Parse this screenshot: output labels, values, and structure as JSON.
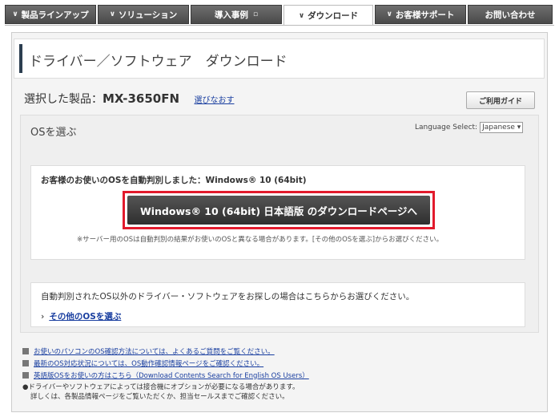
{
  "nav": {
    "tabs": [
      {
        "label": "製品ラインアップ",
        "chevron": true
      },
      {
        "label": "ソリューション",
        "chevron": true
      },
      {
        "label": "導入事例",
        "chevron": false
      },
      {
        "label": "ダウンロード",
        "chevron": true,
        "active": true
      },
      {
        "label": "お客様サポート",
        "chevron": true
      },
      {
        "label": "お問い合わせ",
        "chevron": false
      }
    ]
  },
  "header": {
    "title": "ドライバー／ソフトウェア　ダウンロード"
  },
  "product": {
    "prefix": "選択した製品：",
    "name": "MX-3650FN",
    "reselect_link": "選びなおす",
    "guide_button": "ご利用ガイド"
  },
  "os_panel": {
    "heading": "OSを選ぶ",
    "language_label": "Language Select:",
    "language_value": "Japanese ▾"
  },
  "auto_detect": {
    "message": "お客様のお使いのOSを自動判別しました：Windows® 10 (64bit)",
    "download_button": "Windows® 10 (64bit) 日本語版 のダウンロードページへ",
    "note": "※サーバー用のOSは自動判別の結果がお使いのOSと異なる場合があります。[その他のOSを選ぶ]からお選びください。"
  },
  "other_os": {
    "message": "自動判別されたOS以外のドライバー・ソフトウェアをお探しの場合はこちらからお選びください。",
    "link": "その他のOSを選ぶ"
  },
  "footer": {
    "links": [
      "お使いのパソコンのOS確認方法については、よくあるご質問をご覧ください。",
      "最新のOS対応状況については、OS動作確認情報ページをご確認ください。",
      "英語版OSをお使いの方はこちら（Download Contents Search for English OS Users）"
    ],
    "bullet_line1": "●ドライバーやソフトウェアによっては接合機にオプションが必要になる場合があります。",
    "bullet_line2": "詳しくは、各製品情報ページをご覧いただくか、担当セールスまでご確認ください。"
  },
  "colors": {
    "nav_bg": "#4a4a4a",
    "highlight": "#e21a2c",
    "link": "#1a3fa0"
  }
}
